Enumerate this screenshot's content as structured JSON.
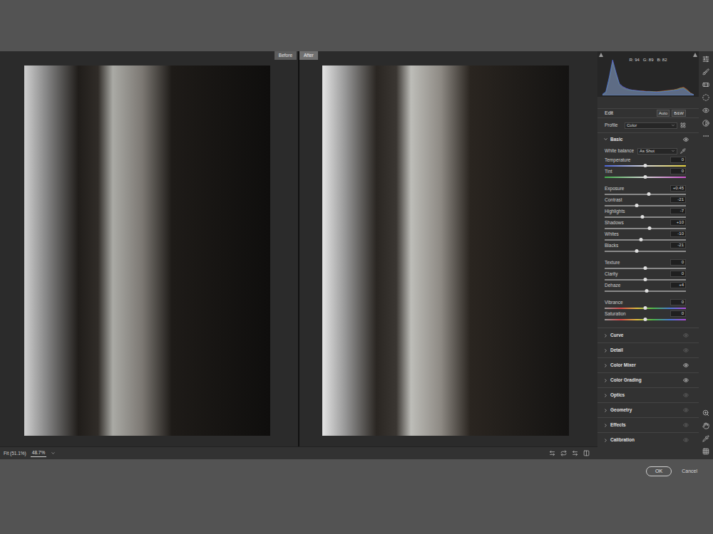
{
  "compare_labels": [
    {
      "label": "Before"
    },
    {
      "label": "After"
    }
  ],
  "histogram": {
    "readout": [
      "R: 94",
      "G: 89",
      "B: 82"
    ],
    "series": [
      {
        "name": "red",
        "color": "#c0504d",
        "values": [
          2,
          6,
          38,
          92,
          58,
          30,
          22,
          18,
          15,
          14,
          13,
          12,
          12,
          11,
          11,
          10,
          10,
          11,
          12,
          13,
          14,
          15,
          17,
          20,
          22,
          16,
          7,
          2
        ]
      },
      {
        "name": "green",
        "color": "#6aa84f",
        "values": [
          2,
          7,
          42,
          88,
          55,
          28,
          20,
          16,
          14,
          13,
          12,
          11,
          11,
          10,
          10,
          10,
          9,
          10,
          11,
          12,
          13,
          14,
          16,
          19,
          20,
          14,
          6,
          2
        ]
      },
      {
        "name": "blue",
        "color": "#4f6fd6",
        "values": [
          3,
          10,
          50,
          96,
          62,
          32,
          24,
          19,
          16,
          14,
          13,
          12,
          11,
          10,
          10,
          9,
          9,
          9,
          10,
          11,
          12,
          13,
          14,
          17,
          18,
          12,
          5,
          2
        ]
      }
    ]
  },
  "edit": {
    "title": "Edit",
    "buttons": [
      "Auto",
      "B&W"
    ]
  },
  "profile": {
    "label": "Profile",
    "value": "Color"
  },
  "basic": {
    "title": "Basic",
    "expanded": true,
    "visible": true,
    "white_balance": {
      "label": "White balance",
      "value": "As Shot"
    },
    "slider_groups": [
      [
        {
          "label": "Temperature",
          "value": "0",
          "level": 0.5,
          "kind": "temperature"
        },
        {
          "label": "Tint",
          "value": "0",
          "level": 0.5,
          "kind": "tint"
        }
      ],
      [
        {
          "label": "Exposure",
          "value": "+0.45",
          "level": 0.545,
          "kind": "plain"
        },
        {
          "label": "Contrast",
          "value": "-21",
          "level": 0.395,
          "kind": "plain"
        },
        {
          "label": "Highlights",
          "value": "-7",
          "level": 0.465,
          "kind": "plain"
        },
        {
          "label": "Shadows",
          "value": "+10",
          "level": 0.55,
          "kind": "plain"
        },
        {
          "label": "Whites",
          "value": "-10",
          "level": 0.45,
          "kind": "plain"
        },
        {
          "label": "Blacks",
          "value": "-21",
          "level": 0.395,
          "kind": "plain"
        }
      ],
      [
        {
          "label": "Texture",
          "value": "0",
          "level": 0.5,
          "kind": "plain"
        },
        {
          "label": "Clarity",
          "value": "0",
          "level": 0.5,
          "kind": "plain"
        },
        {
          "label": "Dehaze",
          "value": "+4",
          "level": 0.52,
          "kind": "plain"
        }
      ],
      [
        {
          "label": "Vibrance",
          "value": "0",
          "level": 0.5,
          "kind": "hue"
        },
        {
          "label": "Saturation",
          "value": "0",
          "level": 0.5,
          "kind": "hue"
        }
      ]
    ]
  },
  "sections": [
    {
      "title": "Curve",
      "expanded": false,
      "visible": false
    },
    {
      "title": "Detail",
      "expanded": false,
      "visible": false
    },
    {
      "title": "Color Mixer",
      "expanded": false,
      "visible": true
    },
    {
      "title": "Color Grading",
      "expanded": false,
      "visible": true
    },
    {
      "title": "Optics",
      "expanded": false,
      "visible": false
    },
    {
      "title": "Geometry",
      "expanded": false,
      "visible": false
    },
    {
      "title": "Effects",
      "expanded": false,
      "visible": false
    },
    {
      "title": "Calibration",
      "expanded": false,
      "visible": false
    }
  ],
  "footer": {
    "zoom_label": "Fit (51.1%)",
    "zoom_value": "48.7%"
  },
  "buttons": [
    {
      "label": "OK",
      "default": true
    },
    {
      "label": "Cancel",
      "default": false
    }
  ]
}
